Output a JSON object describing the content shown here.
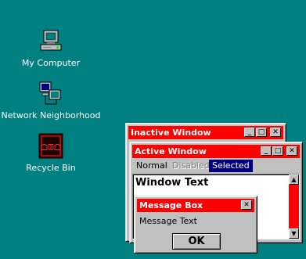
{
  "desktop": {
    "icons": [
      {
        "label": "My Computer",
        "icon": "computer-icon"
      },
      {
        "label": "Network Neighborhood",
        "icon": "network-icon"
      },
      {
        "label": "Recycle Bin",
        "icon": "recycle-bin-icon"
      }
    ],
    "background_color": "#008080"
  },
  "inactive_window": {
    "title": "Inactive Window",
    "title_color": "#ff0000"
  },
  "active_window": {
    "title": "Active Window",
    "menu": {
      "normal": "Normal",
      "disabled": "Disabled",
      "selected": "Selected"
    },
    "body_text": "Window Text",
    "selected_color": "#000080"
  },
  "message_box": {
    "title": "Message Box",
    "text": "Message Text",
    "ok_label": "OK"
  },
  "title_buttons": {
    "minimize": "_",
    "maximize": "□",
    "close": "✕"
  }
}
